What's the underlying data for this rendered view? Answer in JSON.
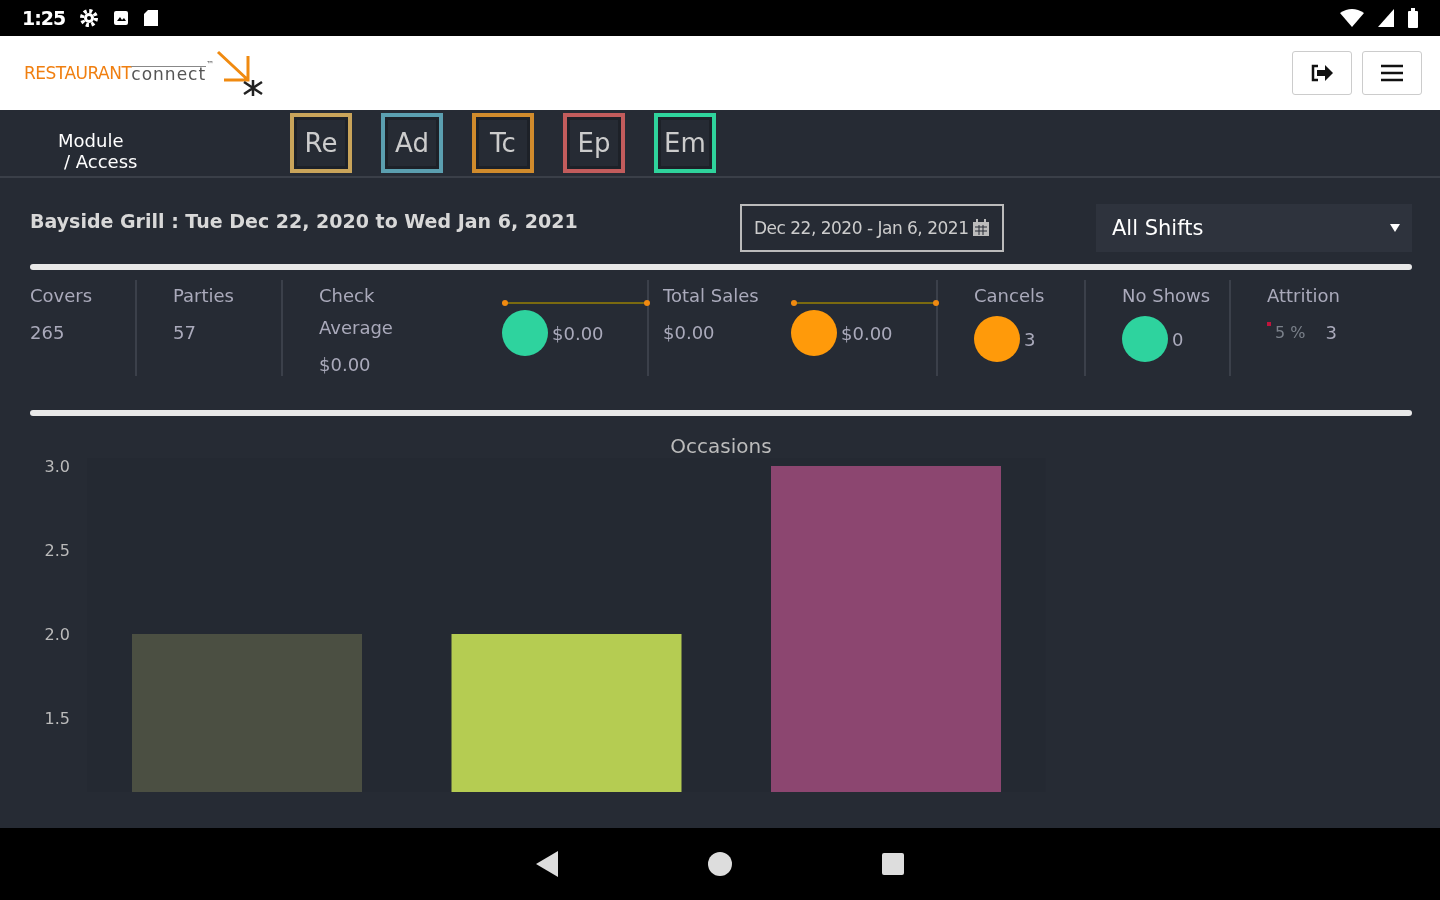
{
  "status_bar": {
    "time": "1:25"
  },
  "header": {
    "logo": {
      "brand": "RESTAURANT",
      "suffix": "connect",
      "mark": "™"
    }
  },
  "module_bar": {
    "label": "Module",
    "sublabel": "/  Access",
    "modules": [
      {
        "label": "Re",
        "color": "#c9a45a"
      },
      {
        "label": "Ad",
        "color": "#5b9fb0"
      },
      {
        "label": "Tc",
        "color": "#d08b2c"
      },
      {
        "label": "Ep",
        "color": "#c25c5c"
      },
      {
        "label": "Em",
        "color": "#2fd39c"
      }
    ]
  },
  "report": {
    "title": "Bayside Grill : Tue Dec 22, 2020 to Wed Jan 6, 2021",
    "date_range": "Dec 22, 2020 - Jan 6, 2021",
    "shift_select": "All Shifts"
  },
  "metrics": [
    {
      "label": "Covers",
      "value": "265"
    },
    {
      "label": "Parties",
      "value": "57"
    },
    {
      "label": "Check Average",
      "value": "$0.00",
      "indicator": {
        "kind": "goal",
        "color": "#2ed39e",
        "value": "$0.00"
      }
    },
    {
      "label": "Total Sales",
      "value": "$0.00",
      "indicator": {
        "kind": "goal",
        "color": "#ff9a0a",
        "value": "$0.00"
      }
    },
    {
      "label": "Cancels",
      "indicator": {
        "kind": "dot",
        "color": "#ff9a0a",
        "value": "3"
      }
    },
    {
      "label": "No Shows",
      "indicator": {
        "kind": "dot",
        "color": "#2ed39e",
        "value": "0"
      }
    },
    {
      "label": "Attrition",
      "indicator": {
        "kind": "percent",
        "color": "#c0143c",
        "percent": "5 %",
        "value": "3"
      }
    }
  ],
  "chart": {
    "chart_data": {
      "type": "bar",
      "title": "Occasions",
      "ylim": [
        1,
        3
      ],
      "yticks": [
        {
          "value": 1.5,
          "label": "1.5"
        },
        {
          "value": 2,
          "label": "2.0"
        },
        {
          "value": 2.5,
          "label": "2.5"
        },
        {
          "value": 3,
          "label": "3.0"
        }
      ],
      "categories": [
        null,
        null,
        null
      ],
      "values": [
        2,
        2,
        3
      ],
      "colors": [
        "#4b4f42",
        "#b5cc52",
        "#8c4670"
      ]
    }
  }
}
